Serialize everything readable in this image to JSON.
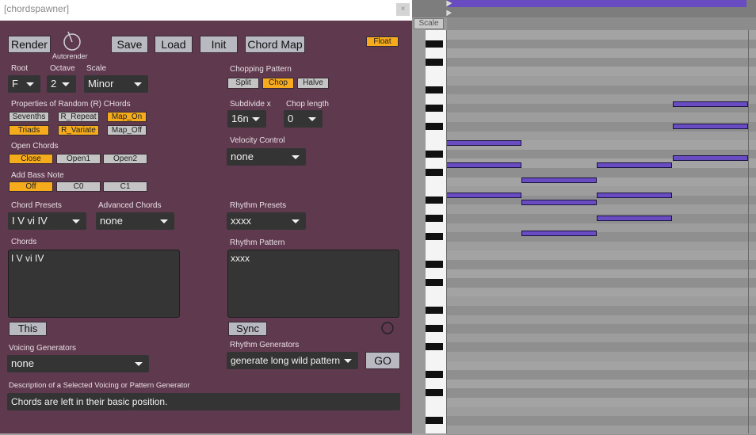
{
  "window": {
    "title": "[chordspawner]",
    "close_label": "×"
  },
  "toolbar": {
    "render": "Render",
    "autorender": "Autorender",
    "save": "Save",
    "load": "Load",
    "init": "Init",
    "chord_map": "Chord Map",
    "float": "Float"
  },
  "root": {
    "label": "Root",
    "value": "F"
  },
  "octave": {
    "label": "Octave",
    "value": "2"
  },
  "scale": {
    "label": "Scale",
    "value": "Minor"
  },
  "random": {
    "label": "Properties of Random (R) CHords",
    "sevenths": "Sevenths",
    "r_repeat": "R_Repeat",
    "map_on": "Map_On",
    "triads": "Triads",
    "r_variate": "R_Variate",
    "map_off": "Map_Off"
  },
  "open_chords": {
    "label": "Open Chords",
    "close": "Close",
    "open1": "Open1",
    "open2": "Open2"
  },
  "bass_note": {
    "label": "Add Bass Note",
    "off": "Off",
    "c0": "C0",
    "c1": "C1"
  },
  "chord_presets": {
    "label": "Chord Presets",
    "value": "I V vi IV"
  },
  "advanced_chords": {
    "label": "Advanced Chords",
    "value": "none"
  },
  "chords": {
    "label": "Chords",
    "value": "I V vi IV",
    "this_button": "This"
  },
  "voicing": {
    "label": "Voicing Generators",
    "value": "none"
  },
  "description": {
    "label": "Description of a Selected Voicing or Pattern Generator",
    "value": "Chords are left in their basic position."
  },
  "chopping": {
    "label": "Chopping Pattern",
    "split": "Split",
    "chop": "Chop",
    "halve": "Halve"
  },
  "subdivide": {
    "label": "Subdivide x",
    "value": "16n"
  },
  "chop_length": {
    "label": "Chop length",
    "value": "0"
  },
  "velocity": {
    "label": "Velocity Control",
    "value": "none"
  },
  "rhythm_presets": {
    "label": "Rhythm Presets",
    "value": "xxxx"
  },
  "rhythm_pattern": {
    "label": "Rhythm Pattern",
    "value": "xxxx",
    "sync_button": "Sync"
  },
  "rhythm_generators": {
    "label": "Rhythm Generators",
    "value": "generate long wild pattern",
    "go": "GO"
  },
  "piano_roll": {
    "scale_label": "Scale",
    "note_color": "#6a4cc2"
  },
  "colors": {
    "panel": "#5f3a4f",
    "accent_on": "#f5ab1c",
    "note": "#6a4cc2"
  }
}
